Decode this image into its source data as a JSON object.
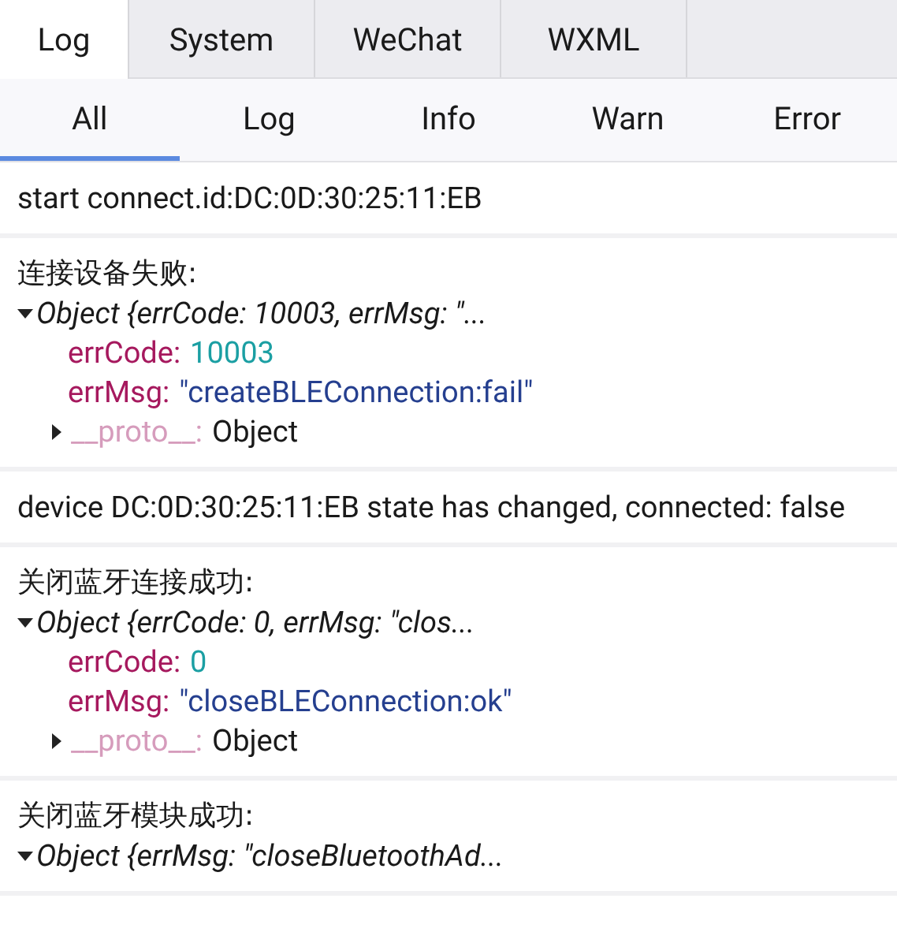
{
  "tabs": [
    {
      "label": "Log",
      "selected": true
    },
    {
      "label": "System",
      "selected": false
    },
    {
      "label": "WeChat",
      "selected": false
    },
    {
      "label": "WXML",
      "selected": false
    }
  ],
  "filters": [
    {
      "label": "All",
      "selected": true
    },
    {
      "label": "Log",
      "selected": false
    },
    {
      "label": "Info",
      "selected": false
    },
    {
      "label": "Warn",
      "selected": false
    },
    {
      "label": "Error",
      "selected": false
    }
  ],
  "entries": [
    {
      "kind": "text",
      "text": "start connect.id:DC:0D:30:25:11:EB"
    },
    {
      "kind": "object",
      "title": "连接设备失败:",
      "summary": "Object {errCode: 10003, errMsg: \"...",
      "expanded": true,
      "props": [
        {
          "key": "errCode:",
          "value": "10003",
          "kind": "number"
        },
        {
          "key": "errMsg:",
          "value": "\"createBLEConnection:fail\"",
          "kind": "string"
        }
      ],
      "proto": {
        "key": "__proto__:",
        "value": "Object",
        "expanded": false
      }
    },
    {
      "kind": "text",
      "text": "device DC:0D:30:25:11:EB state has changed, connected: false"
    },
    {
      "kind": "object",
      "title": "关闭蓝牙连接成功:",
      "summary": "Object {errCode: 0, errMsg: \"clos...",
      "expanded": true,
      "props": [
        {
          "key": "errCode:",
          "value": "0",
          "kind": "number"
        },
        {
          "key": "errMsg:",
          "value": "\"closeBLEConnection:ok\"",
          "kind": "string"
        }
      ],
      "proto": {
        "key": "__proto__:",
        "value": "Object",
        "expanded": false
      }
    },
    {
      "kind": "object",
      "title": "关闭蓝牙模块成功:",
      "summary": "Object {errMsg: \"closeBluetoothAd...",
      "expanded": true
    }
  ]
}
